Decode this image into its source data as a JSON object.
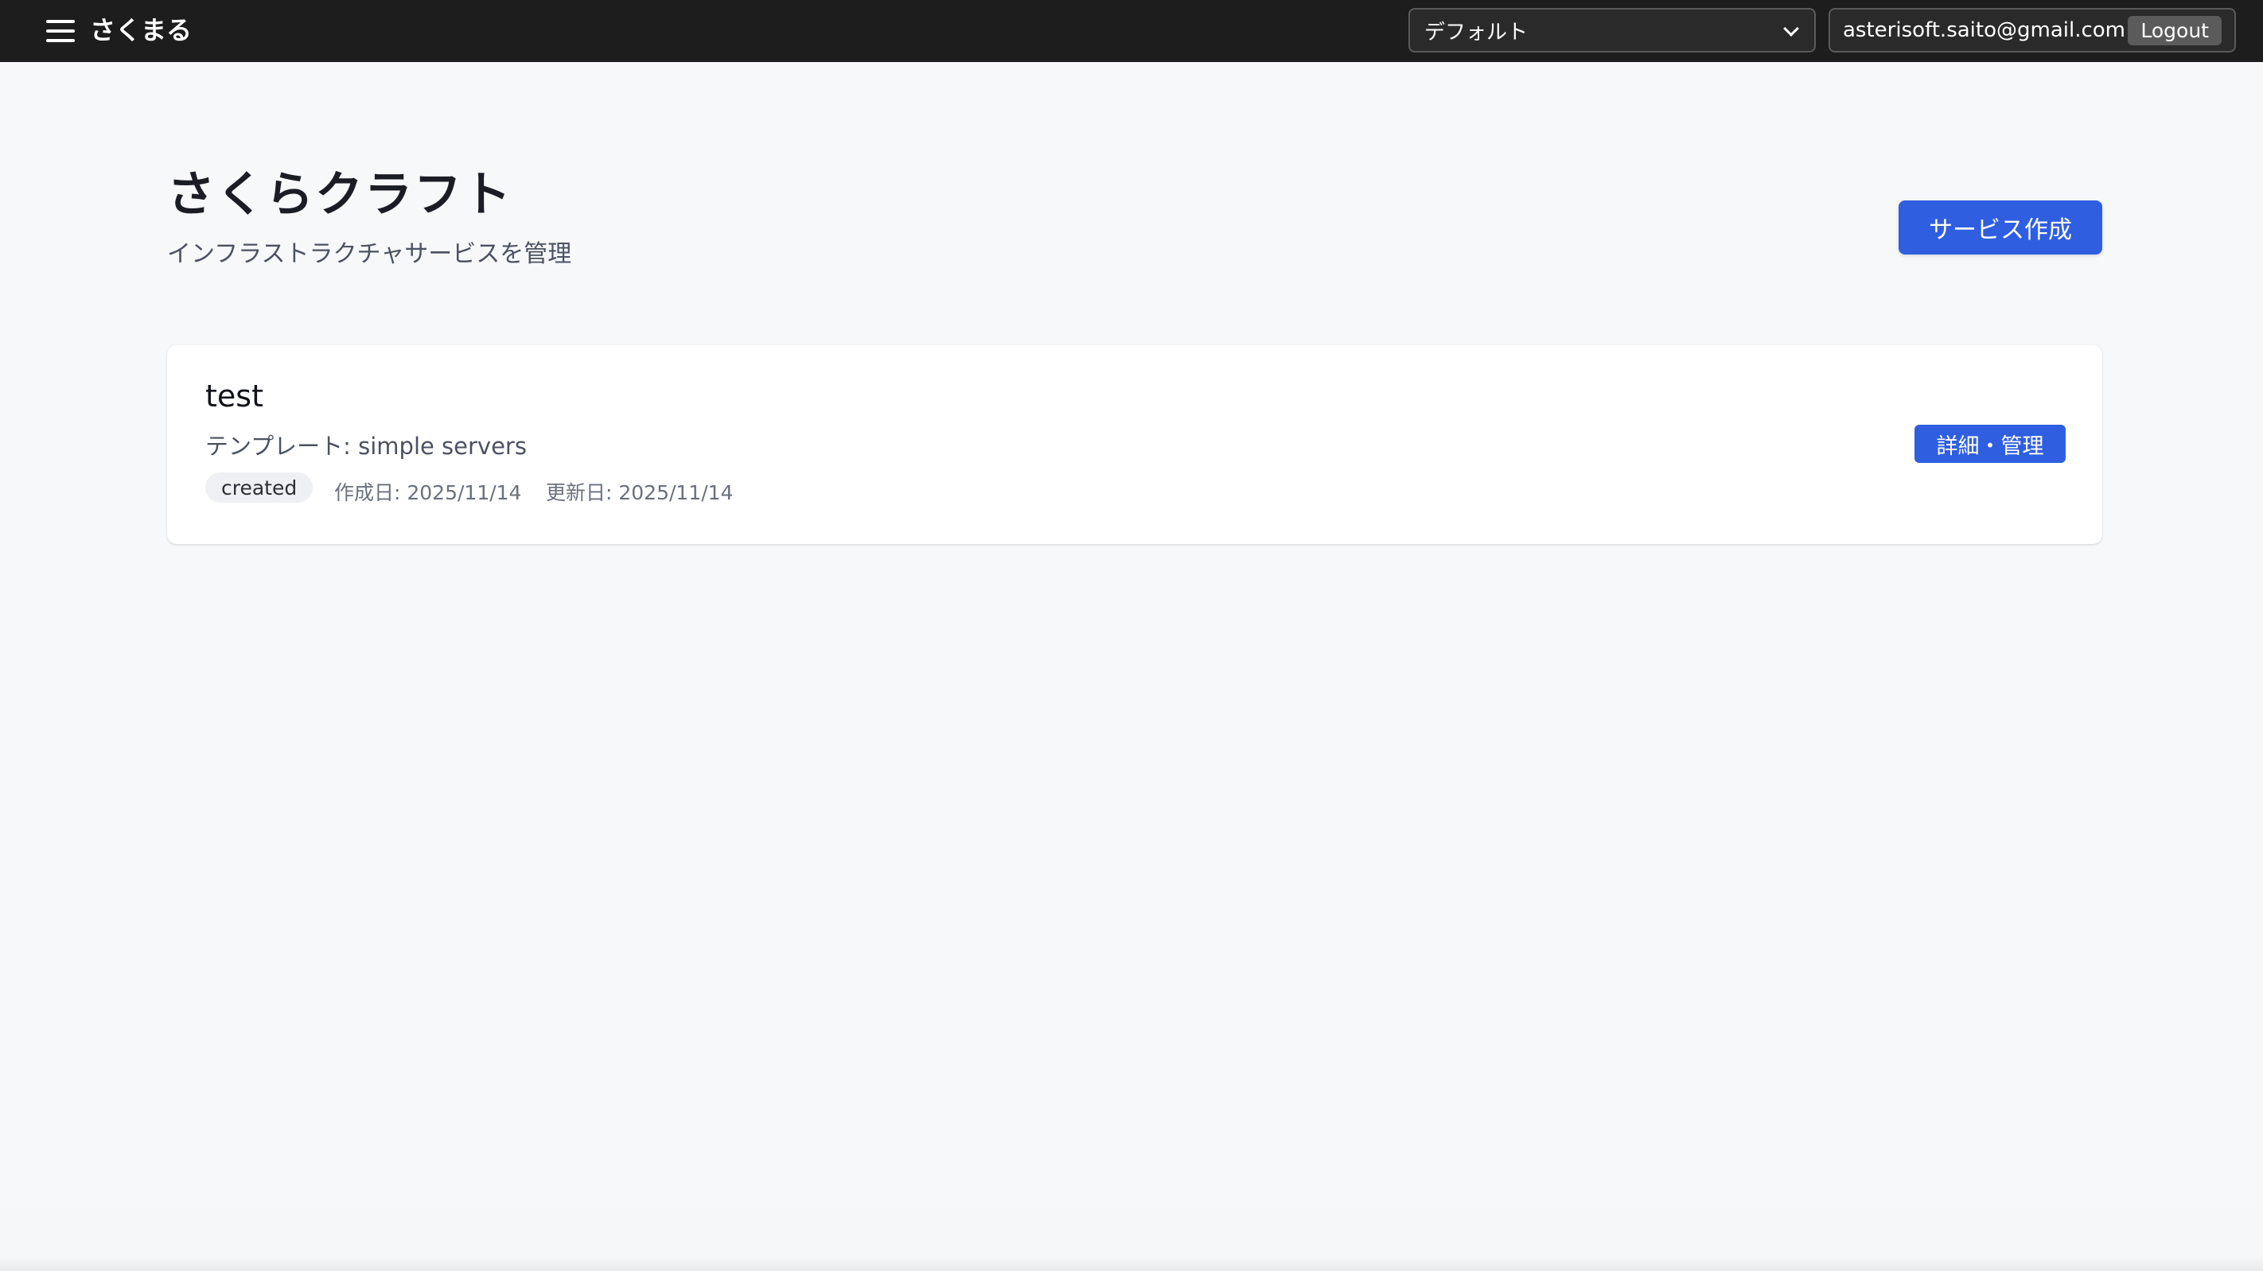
{
  "header": {
    "brand": "さくまる",
    "project_select": {
      "selected": "デフォルト"
    },
    "user": {
      "email": "asterisoft.saito@gmail.com",
      "logout_label": "Logout"
    }
  },
  "page": {
    "title": "さくらクラフト",
    "subtitle": "インフラストラクチャサービスを管理",
    "create_button_label": "サービス作成"
  },
  "services": [
    {
      "name": "test",
      "template": "テンプレート: simple servers",
      "status": "created",
      "created": "作成日: 2025/11/14",
      "updated": "更新日: 2025/11/14",
      "action_label": "詳細・管理"
    }
  ],
  "colors": {
    "topbar": "#1d1d1d",
    "accent": "#2f5fe0",
    "background": "#f7f8fa"
  },
  "icons": {
    "menu": "hamburger-menu-icon",
    "select": "chevron-down-icon"
  }
}
